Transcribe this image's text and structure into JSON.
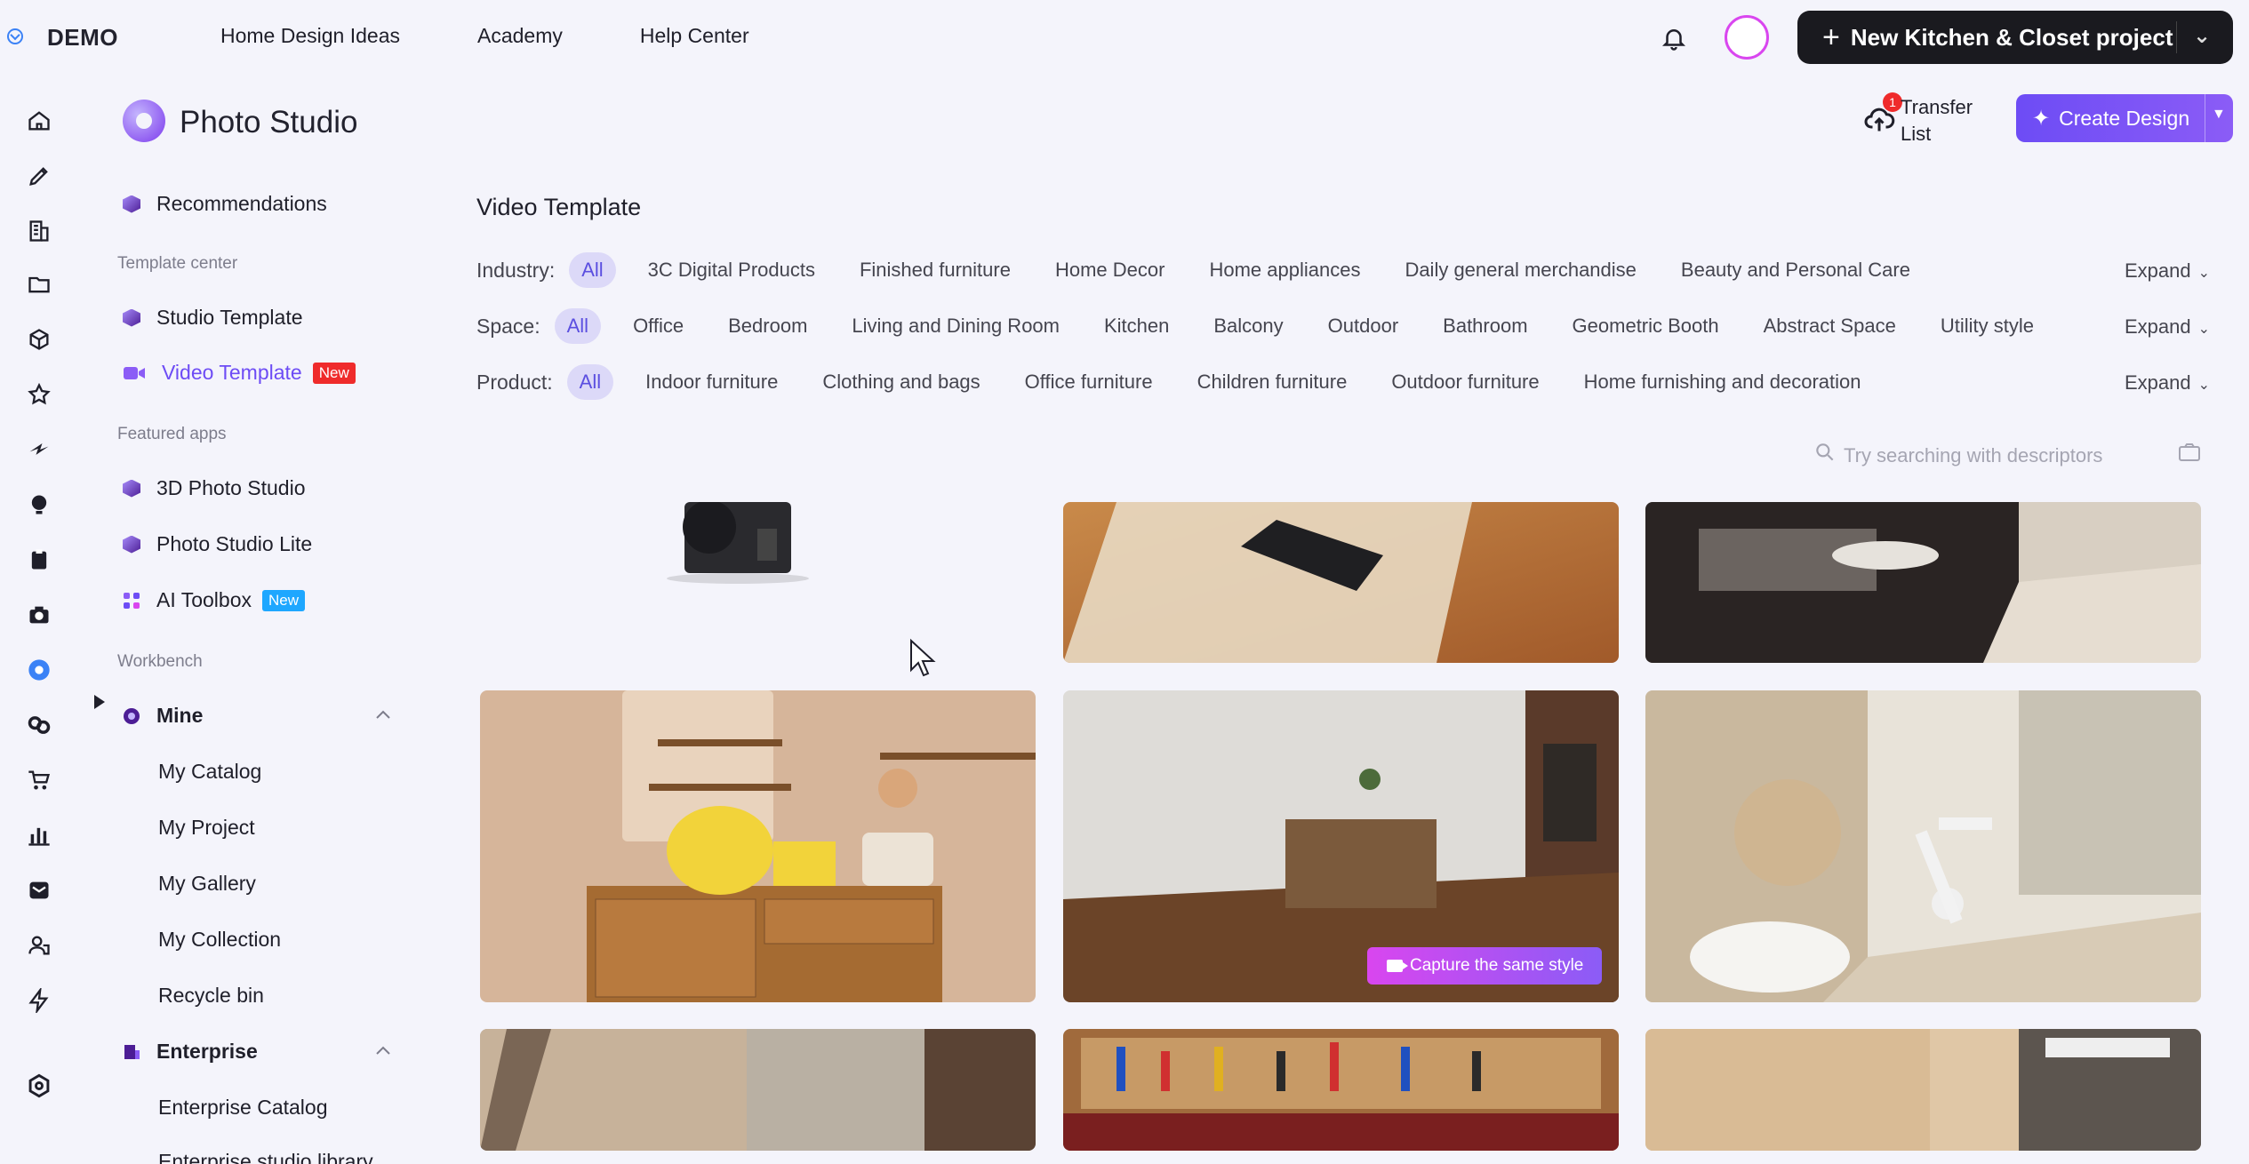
{
  "topbar": {
    "brand": "DEMO",
    "nav": [
      "Home Design Ideas",
      "Academy",
      "Help Center"
    ],
    "new_project_label": "New Kitchen & Closet project"
  },
  "rail_icons": [
    "home-icon",
    "pen-icon",
    "building-icon",
    "folder-icon",
    "cube-icon",
    "star-icon",
    "bolt-icon",
    "bulb-icon",
    "clipboard-icon",
    "camera-icon",
    "photo-studio-icon",
    "link-icon",
    "cart-icon",
    "chart-icon",
    "mail-icon",
    "team-icon",
    "flash-icon",
    "settings-icon"
  ],
  "sidebar": {
    "title": "Photo Studio",
    "recommendations": "Recommendations",
    "section_template": "Template center",
    "studio_template": "Studio Template",
    "video_template": "Video Template",
    "video_template_badge": "New",
    "section_featured": "Featured apps",
    "photo_studio_3d": "3D Photo Studio",
    "photo_studio_lite": "Photo Studio Lite",
    "ai_toolbox": "AI Toolbox",
    "ai_toolbox_badge": "New",
    "section_workbench": "Workbench",
    "mine": "Mine",
    "mine_items": [
      "My Catalog",
      "My Project",
      "My Gallery",
      "My Collection",
      "Recycle bin"
    ],
    "enterprise": "Enterprise",
    "enterprise_items": [
      "Enterprise Catalog",
      "Enterprise studio library"
    ]
  },
  "header": {
    "transfer_count": "1",
    "transfer_label": "Transfer List",
    "create_label": "Create Design"
  },
  "main": {
    "title": "Video Template",
    "filters": [
      {
        "label": "Industry:",
        "options": [
          "All",
          "3C Digital Products",
          "Finished furniture",
          "Home Decor",
          "Home appliances",
          "Daily general merchandise",
          "Beauty and Personal Care"
        ]
      },
      {
        "label": "Space:",
        "options": [
          "All",
          "Office",
          "Bedroom",
          "Living and Dining Room",
          "Kitchen",
          "Balcony",
          "Outdoor",
          "Bathroom",
          "Geometric Booth",
          "Abstract Space",
          "Utility style"
        ]
      },
      {
        "label": "Product:",
        "options": [
          "All",
          "Indoor furniture",
          "Clothing and bags",
          "Office furniture",
          "Children furniture",
          "Outdoor furniture",
          "Home furnishing and decoration"
        ]
      }
    ],
    "expand_label": "Expand",
    "search_placeholder": "Try searching with descriptors",
    "capture_label": "Capture the same style"
  },
  "colors": {
    "accent": "#6d4cf5",
    "chip_active_bg": "#dcd9f8",
    "new_badge_red": "#ef2b2b",
    "new_badge_blue": "#1ea7ff"
  }
}
